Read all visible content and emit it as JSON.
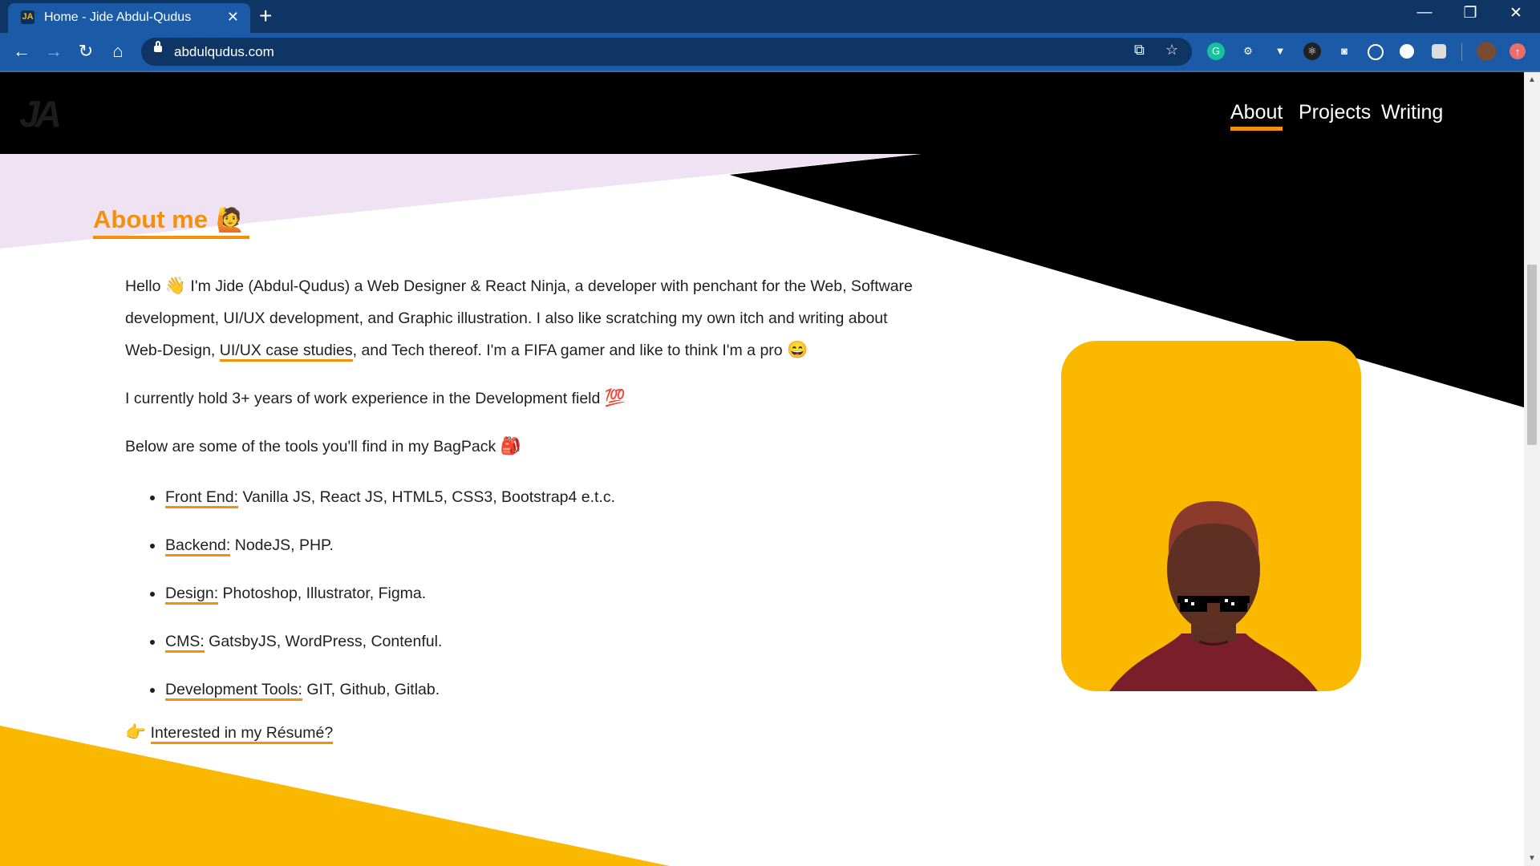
{
  "browser": {
    "tab_title": "Home - Jide Abdul-Qudus",
    "tab_favicon_text": "JA",
    "url": "abdulqudus.com",
    "tab_close": "✕",
    "new_tab": "+",
    "back": "←",
    "forward": "→",
    "reload": "↻",
    "home": "⌂",
    "minimize": "—",
    "restore": "❐",
    "close": "✕",
    "extensions": [
      "grammarly-icon",
      "gear-extension-icon",
      "vue-devtools-icon",
      "react-devtools-icon",
      "camera-extension-icon",
      "target-extension-icon",
      "circle-extension-icon",
      "square-extension-icon"
    ]
  },
  "site": {
    "logo": "JA",
    "nav": [
      {
        "label": "About",
        "active": true
      },
      {
        "label": "Projects",
        "active": false
      },
      {
        "label": "Writing",
        "active": false
      }
    ]
  },
  "about": {
    "title": "About me",
    "title_emoji": "🙋",
    "intro": {
      "p1": "Hello",
      "wave": "👋",
      "p2": " I'm Jide (Abdul-Qudus) a Web Designer & React Ninja, a developer with penchant for the Web, Software development, UI/UX development, and Graphic illustration. I also like scratching my own itch and writing about Web-Design, ",
      "link": "UI/UX case studies",
      "p3": ", and Tech thereof. I'm a FIFA gamer and like to think I'm a pro ",
      "grin": "😄"
    },
    "experience": {
      "text": "I currently hold 3+ years of work experience in the Development field ",
      "emoji": "💯"
    },
    "tools_intro": {
      "text": "Below are some of the tools you'll find in my BagPack ",
      "emoji": "🎒"
    },
    "tools": [
      {
        "key": "Front End:",
        "value": " Vanilla JS, React JS, HTML5, CSS3, Bootstrap4 e.t.c."
      },
      {
        "key": "Backend:",
        "value": " NodeJS, PHP."
      },
      {
        "key": "Design:",
        "value": " Photoshop, Illustrator, Figma."
      },
      {
        "key": "CMS:",
        "value": " GatsbyJS, WordPress, Contenful."
      },
      {
        "key": "Development Tools:",
        "value": " GIT, Github, Gitlab."
      }
    ],
    "resume": {
      "emoji": "👉",
      "link": "Interested in my Résumé?"
    }
  },
  "colors": {
    "accent": "#f5900c",
    "yellow": "#fbb800",
    "lavender": "#efe3f3",
    "chrome_dark": "#0f3565",
    "chrome": "#1a5aa7"
  }
}
